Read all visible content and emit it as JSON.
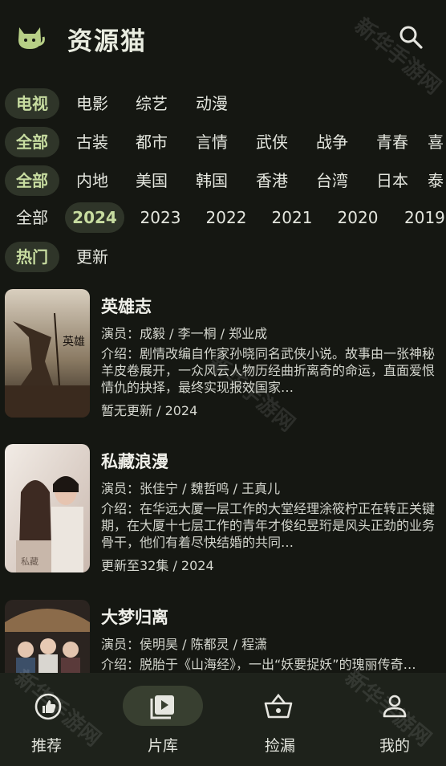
{
  "app": {
    "title": "资源猫"
  },
  "filters": {
    "type": [
      "电视",
      "电影",
      "综艺",
      "动漫"
    ],
    "genre": [
      "全部",
      "古装",
      "都市",
      "言情",
      "武侠",
      "战争",
      "青春",
      "喜"
    ],
    "region": [
      "全部",
      "内地",
      "美国",
      "韩国",
      "香港",
      "台湾",
      "日本",
      "泰"
    ],
    "year": [
      "全部",
      "2024",
      "2023",
      "2022",
      "2021",
      "2020",
      "2019"
    ],
    "sort": [
      "热门",
      "更新"
    ]
  },
  "items": [
    {
      "title": "英雄志",
      "cast": "演员：成毅 / 李一桐 / 郑业成",
      "intro": "介绍：剧情改编自作家孙晓同名武侠小说。故事由一张神秘羊皮卷展开，一众风云人物历经曲折离奇的命运，直面爱恨情仇的抉择，最终实现报效国家…",
      "status": "暂无更新 / 2024"
    },
    {
      "title": "私藏浪漫",
      "cast": "演员：张佳宁 / 魏哲鸣 / 王真儿",
      "intro": "介绍：在华远大厦一层工作的大堂经理涂筱柠正在转正关键期，在大厦十七层工作的青年才俊纪昱珩是风头正劲的业务骨干，他们有着尽快结婚的共同…",
      "status": "更新至32集 / 2024"
    },
    {
      "title": "大梦归离",
      "cast": "演员：侯明昊 / 陈都灵 / 程潇",
      "intro": "介绍：脱胎于《山海经》，一出“妖要捉妖”的瑰丽传奇…",
      "status": ""
    }
  ],
  "nav": [
    {
      "label": "推荐",
      "icon": "thumb-up-icon"
    },
    {
      "label": "片库",
      "icon": "video-library-icon"
    },
    {
      "label": "捡漏",
      "icon": "basket-icon"
    },
    {
      "label": "我的",
      "icon": "person-icon"
    }
  ],
  "watermark": "新华手游网",
  "colors": {
    "accent": "#c7dca0",
    "background": "#151712",
    "chip_bg": "#2f3529"
  }
}
